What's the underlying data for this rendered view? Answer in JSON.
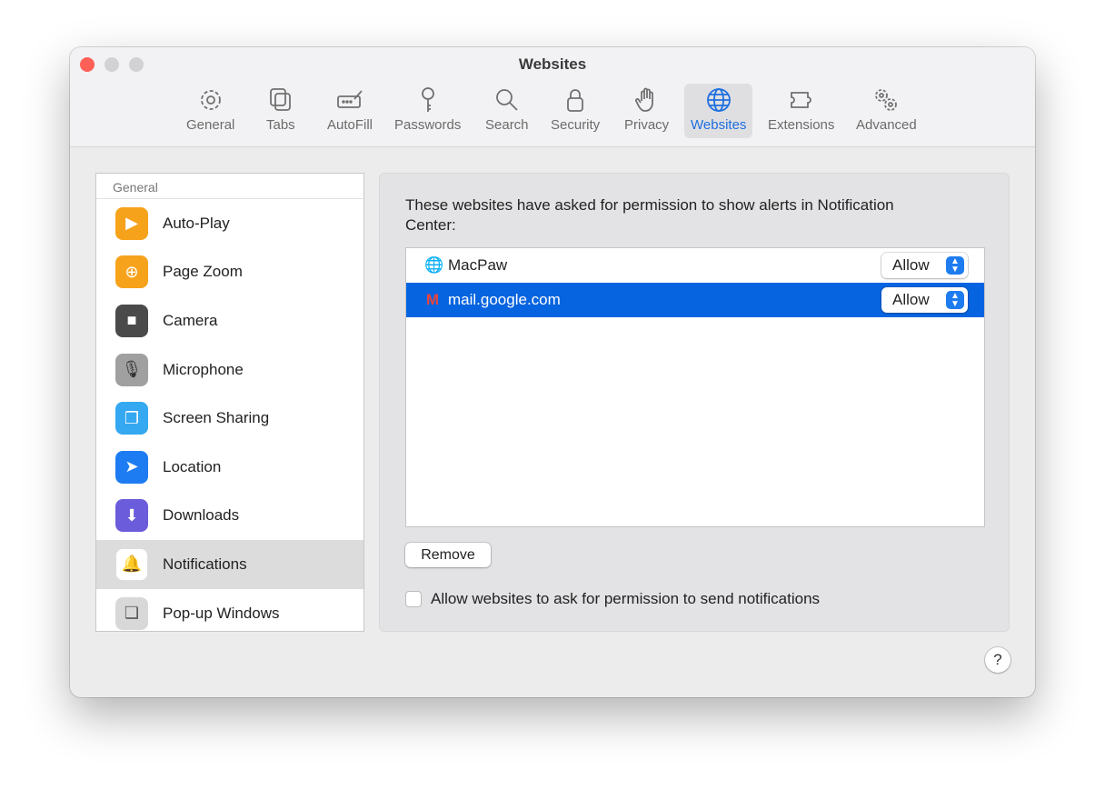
{
  "window": {
    "title": "Websites"
  },
  "toolbar": [
    {
      "label": "General",
      "icon": "gear-icon"
    },
    {
      "label": "Tabs",
      "icon": "tabs-icon"
    },
    {
      "label": "AutoFill",
      "icon": "autofill-icon"
    },
    {
      "label": "Passwords",
      "icon": "key-icon"
    },
    {
      "label": "Search",
      "icon": "search-icon"
    },
    {
      "label": "Security",
      "icon": "lock-icon"
    },
    {
      "label": "Privacy",
      "icon": "hand-icon"
    },
    {
      "label": "Websites",
      "icon": "globe-icon"
    },
    {
      "label": "Extensions",
      "icon": "puzzle-icon"
    },
    {
      "label": "Advanced",
      "icon": "gears-icon"
    }
  ],
  "sidebar": {
    "header": "General",
    "items": [
      {
        "label": "Auto-Play",
        "color": "#f7a21b"
      },
      {
        "label": "Page Zoom",
        "color": "#f7a21b"
      },
      {
        "label": "Camera",
        "color": "#4a4a4a"
      },
      {
        "label": "Microphone",
        "color": "#9a9a9a"
      },
      {
        "label": "Screen Sharing",
        "color": "#34a8f0"
      },
      {
        "label": "Location",
        "color": "#1d7cf2"
      },
      {
        "label": "Downloads",
        "color": "#6a5cdb"
      },
      {
        "label": "Notifications",
        "color": "#ffffff"
      },
      {
        "label": "Pop-up Windows",
        "color": "#d8d8d8"
      }
    ]
  },
  "main": {
    "description": "These websites have asked for permission to show alerts in Notification Center:",
    "sites": [
      {
        "name": "MacPaw",
        "permission": "Allow"
      },
      {
        "name": "mail.google.com",
        "permission": "Allow"
      }
    ],
    "remove_label": "Remove",
    "checkbox_label": "Allow websites to ask for permission to send notifications",
    "checkbox_checked": false,
    "help_label": "?"
  }
}
